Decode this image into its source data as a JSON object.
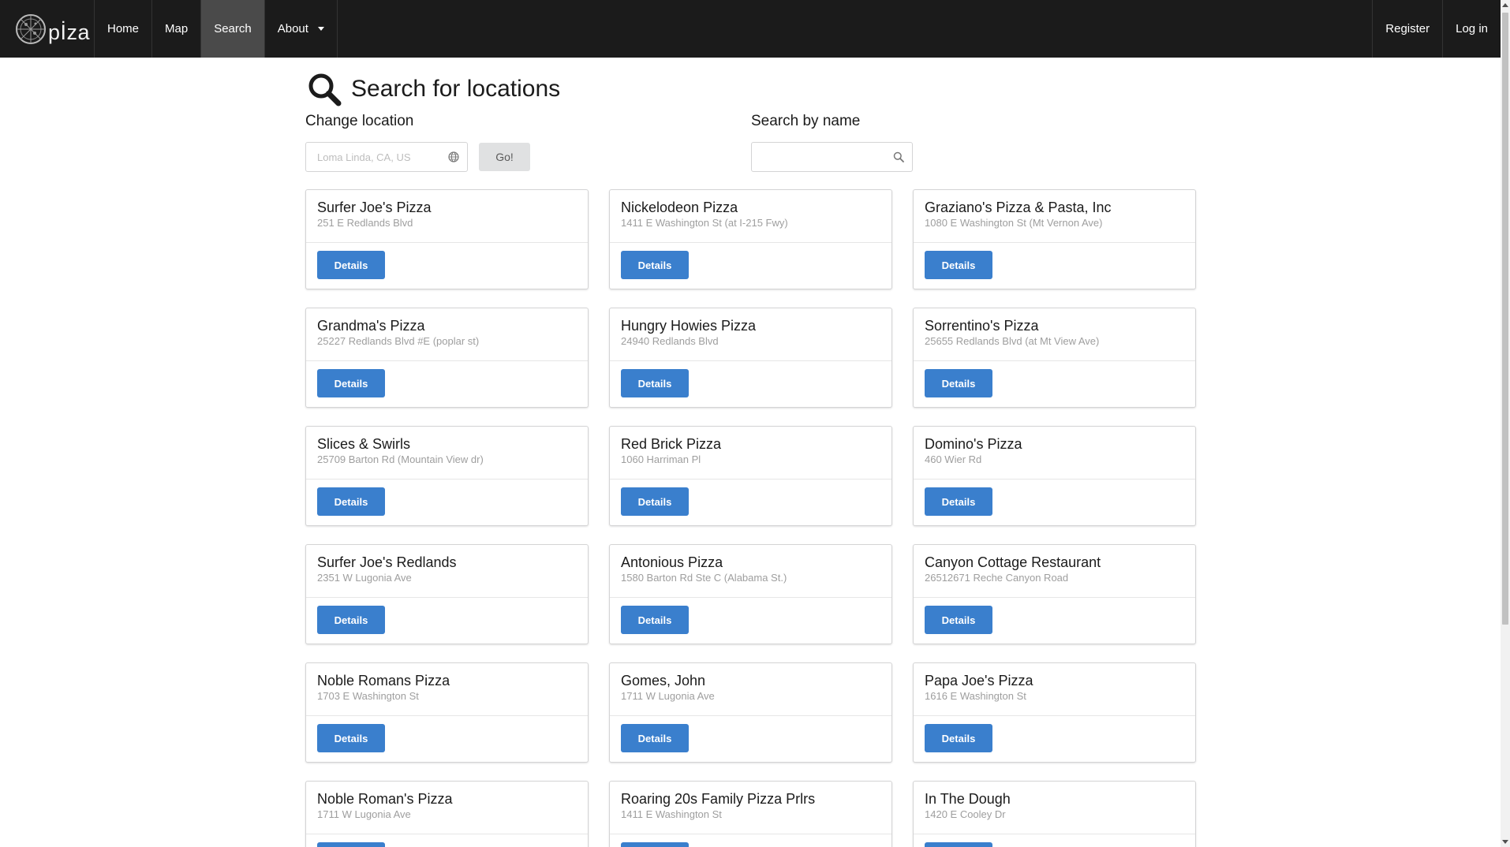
{
  "nav": {
    "logo_text": "pİza",
    "items": [
      {
        "label": "Home"
      },
      {
        "label": "Map"
      },
      {
        "label": "Search"
      },
      {
        "label": "About"
      }
    ],
    "right_items": [
      {
        "label": "Register"
      },
      {
        "label": "Log in"
      }
    ]
  },
  "page": {
    "title": "Search for locations"
  },
  "location": {
    "label": "Change location",
    "placeholder": "Loma Linda, CA, US",
    "go_label": "Go!"
  },
  "name_search": {
    "label": "Search by name",
    "value": ""
  },
  "details_label": "Details",
  "results": [
    {
      "name": "Surfer Joe's Pizza",
      "address": "251 E Redlands Blvd"
    },
    {
      "name": "Nickelodeon Pizza",
      "address": "1411 E Washington St (at I-215 Fwy)"
    },
    {
      "name": "Graziano's Pizza & Pasta, Inc",
      "address": "1080 E Washington St (Mt Vernon Ave)"
    },
    {
      "name": "Grandma's Pizza",
      "address": "25227 Redlands Blvd #E (poplar st)"
    },
    {
      "name": "Hungry Howies Pizza",
      "address": "24940 Redlands Blvd"
    },
    {
      "name": "Sorrentino's Pizza",
      "address": "25655 Redlands Blvd (at Mt View Ave)"
    },
    {
      "name": "Slices & Swirls",
      "address": "25709 Barton Rd (Mountain View dr)"
    },
    {
      "name": "Red Brick Pizza",
      "address": "1060 Harriman Pl"
    },
    {
      "name": "Domino's Pizza",
      "address": "460 Wier Rd"
    },
    {
      "name": "Surfer Joe's Redlands",
      "address": "2351 W Lugonia Ave"
    },
    {
      "name": "Antonious Pizza",
      "address": "1580 Barton Rd Ste C (Alabama St.)"
    },
    {
      "name": "Canyon Cottage Restaurant",
      "address": "26512671 Reche Canyon Road"
    },
    {
      "name": "Noble Romans Pizza",
      "address": "1703 E Washington St"
    },
    {
      "name": "Gomes, John",
      "address": "1711 W Lugonia Ave"
    },
    {
      "name": "Papa Joe's Pizza",
      "address": "1616 E Washington St"
    },
    {
      "name": "Noble Roman's Pizza",
      "address": "1711 W Lugonia Ave"
    },
    {
      "name": "Roaring 20s Family Pizza Prlrs",
      "address": "1411 E Washington St"
    },
    {
      "name": "In The Dough",
      "address": "1420 E Cooley Dr"
    }
  ],
  "colors": {
    "navbar": "#1b1b1b",
    "nav_active": "#4a4a4a",
    "primary_button": "#3a7fcd",
    "go_button": "#e0e1e2"
  },
  "icons": {
    "logo": "pizza-logo-icon",
    "title": "search-icon",
    "location_field": "globe-icon",
    "name_field": "search-icon",
    "about_dropdown": "caret-down-icon"
  }
}
